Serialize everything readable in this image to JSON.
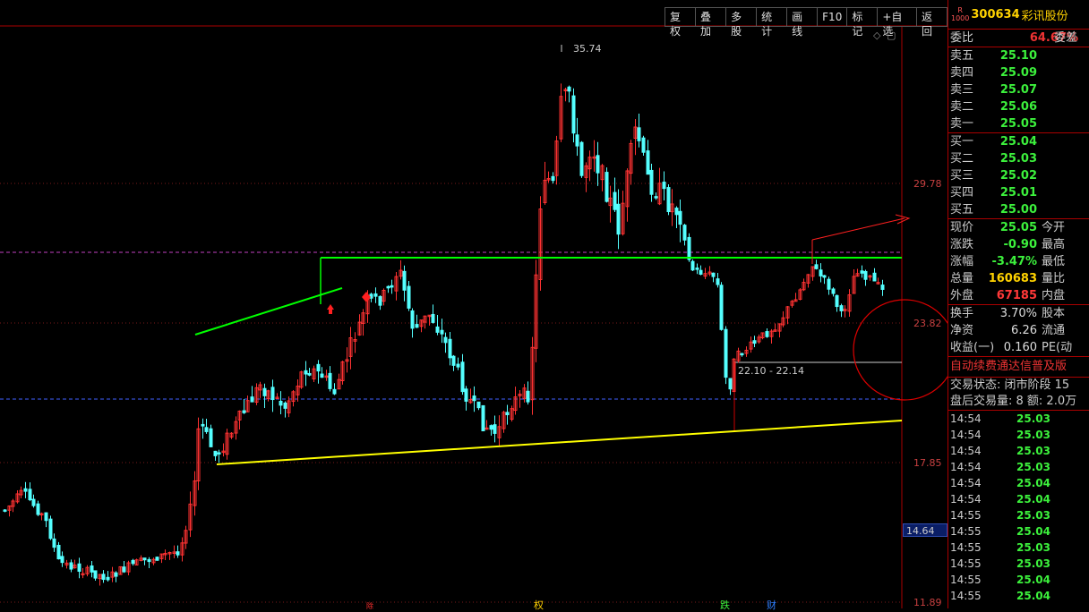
{
  "toolbar": [
    "复权",
    "叠加",
    "多股",
    "统计",
    "画线",
    "F10",
    "标记",
    "+自选",
    "返回"
  ],
  "chart": {
    "price_labels": [
      "29.78",
      "23.82",
      "17.85",
      "11.89"
    ],
    "current_price_tag": "14.64",
    "high_label": "35.74",
    "range_label": "22.10 - 22.14",
    "bottom_marks": [
      "权",
      "除",
      "跌",
      "财"
    ],
    "colors": {
      "up": "#ff3232",
      "down": "#54ffff",
      "support": "#ffff00",
      "resistance": "#00ff00",
      "accent": "#ff2020"
    }
  },
  "chart_data": {
    "type": "candlestick",
    "y_axis": [
      29.78,
      23.82,
      17.85,
      11.89
    ],
    "annotations": [
      "35.74",
      "22.10 - 22.14"
    ]
  },
  "quote": {
    "badge": "R\n1000",
    "code": "300634",
    "name": "彩讯股份",
    "webi_label": "委比",
    "webi_value": "64.67%",
    "weicha_label": "委差",
    "sell": [
      {
        "label": "卖五",
        "price": "25.10"
      },
      {
        "label": "卖四",
        "price": "25.09"
      },
      {
        "label": "卖三",
        "price": "25.07"
      },
      {
        "label": "卖二",
        "price": "25.06"
      },
      {
        "label": "卖一",
        "price": "25.05"
      }
    ],
    "buy": [
      {
        "label": "买一",
        "price": "25.04"
      },
      {
        "label": "买二",
        "price": "25.03"
      },
      {
        "label": "买三",
        "price": "25.02"
      },
      {
        "label": "买四",
        "price": "25.01"
      },
      {
        "label": "买五",
        "price": "25.00"
      }
    ],
    "stats": [
      {
        "label": "现价",
        "value": "25.05",
        "label2": "今开"
      },
      {
        "label": "涨跌",
        "value": "-0.90",
        "label2": "最高"
      },
      {
        "label": "涨幅",
        "value": "-3.47%",
        "label2": "最低"
      },
      {
        "label": "总量",
        "value": "160683",
        "label2": "量比"
      },
      {
        "label": "外盘",
        "value": "67185",
        "label2": "内盘"
      }
    ],
    "stats2": [
      {
        "label": "换手",
        "value": "3.70%",
        "label2": "股本"
      },
      {
        "label": "净资",
        "value": "6.26",
        "label2": "流通"
      },
      {
        "label": "收益(一)",
        "value": "0.160",
        "label2": "PE(动"
      }
    ],
    "scroll_text": "自动续费通达信普及版",
    "trade_status": "交易状态: 闭市阶段 15",
    "after_hours": "盘后交易量: 8  额: 2.0万",
    "ticks": [
      {
        "time": "14:54",
        "price": "25.03",
        "color": "green"
      },
      {
        "time": "14:54",
        "price": "25.03",
        "color": "green"
      },
      {
        "time": "14:54",
        "price": "25.03",
        "color": "green"
      },
      {
        "time": "14:54",
        "price": "25.03",
        "color": "green"
      },
      {
        "time": "14:54",
        "price": "25.04",
        "color": "green"
      },
      {
        "time": "14:54",
        "price": "25.04",
        "color": "green"
      },
      {
        "time": "14:55",
        "price": "25.03",
        "color": "green"
      },
      {
        "time": "14:55",
        "price": "25.04",
        "color": "green"
      },
      {
        "time": "14:55",
        "price": "25.03",
        "color": "green"
      },
      {
        "time": "14:55",
        "price": "25.03",
        "color": "green"
      },
      {
        "time": "14:55",
        "price": "25.04",
        "color": "green"
      },
      {
        "time": "14:55",
        "price": "25.04",
        "color": "green"
      }
    ]
  }
}
